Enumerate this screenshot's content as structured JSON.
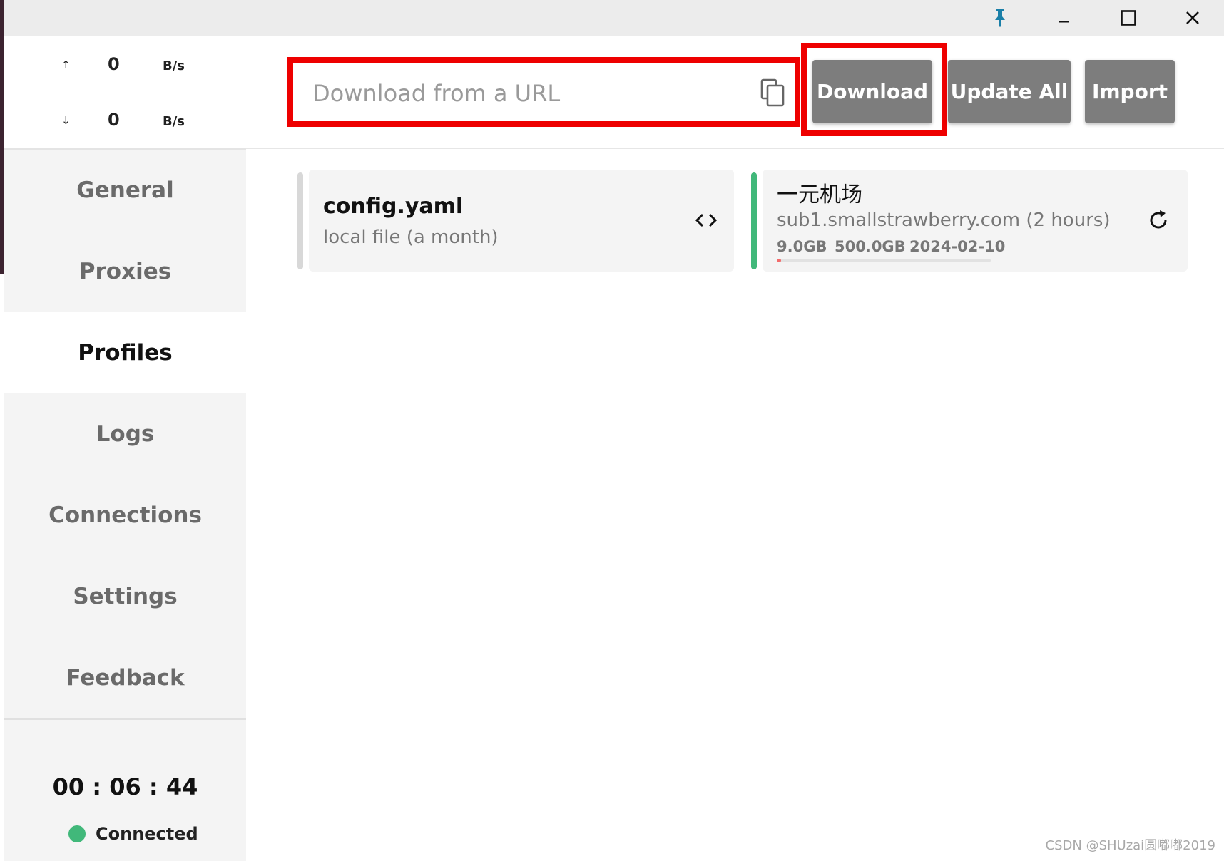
{
  "window": {
    "pin_icon": "pin-icon",
    "minimize_icon": "minimize-icon",
    "maximize_icon": "maximize-icon",
    "close_icon": "close-icon",
    "pin_color": "#1a7fa8"
  },
  "traffic": {
    "upload": {
      "arrow": "↑",
      "value": "0",
      "unit": "B/s"
    },
    "download": {
      "arrow": "↓",
      "value": "0",
      "unit": "B/s"
    }
  },
  "nav": {
    "items": [
      {
        "label": "General"
      },
      {
        "label": "Proxies"
      },
      {
        "label": "Profiles",
        "active": true
      },
      {
        "label": "Logs"
      },
      {
        "label": "Connections"
      },
      {
        "label": "Settings"
      },
      {
        "label": "Feedback"
      }
    ]
  },
  "footer": {
    "timer": "00 : 06 : 44",
    "status": "Connected",
    "status_color": "#41b87a"
  },
  "toolbar": {
    "url_placeholder": "Download from a URL",
    "url_value": "",
    "download_label": "Download",
    "update_all_label": "Update All",
    "import_label": "Import",
    "highlight_color": "#ee0000"
  },
  "profiles": [
    {
      "name": "config.yaml",
      "subtitle": "local file (a month)",
      "action_icon": "code-icon",
      "selected": false
    },
    {
      "name": "一元机场",
      "subtitle": "sub1.smallstrawberry.com (2 hours)",
      "used": "9.0GB",
      "total": "500.0GB",
      "expire": "2024-02-10",
      "usage_fraction": 0.018,
      "action_icon": "refresh-icon",
      "selected": true,
      "accent": "#41b87a"
    }
  ],
  "watermark": "CSDN @SHUzai圆嘟嘟2019"
}
